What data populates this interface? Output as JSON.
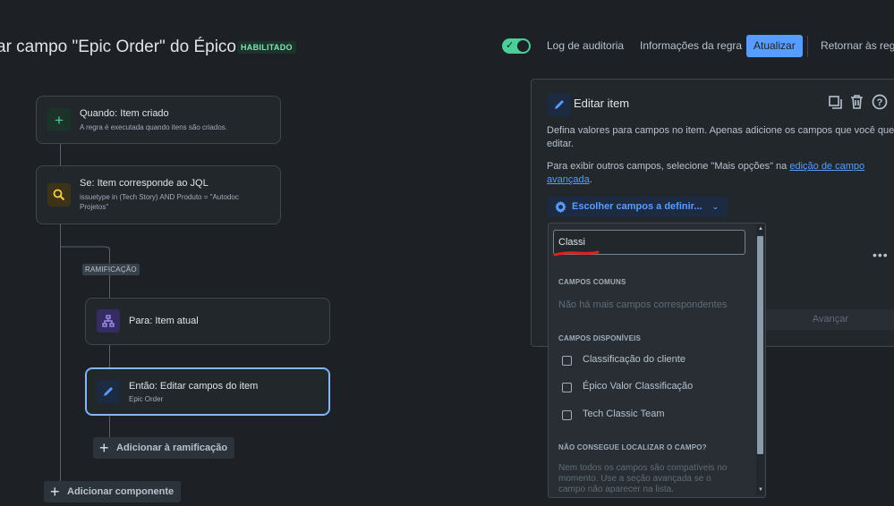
{
  "header": {
    "title": "ar campo \"Epic Order\" do Épico",
    "status": "HABILITADO",
    "toggle_on": true,
    "audit_log": "Log de auditoria",
    "rule_info": "Informações da regra",
    "update": "Atualizar",
    "return_rules": "Retornar às regra"
  },
  "flow": {
    "trigger": {
      "title": "Quando: Item criado",
      "subtitle": "A regra é executada quando itens são criados.",
      "icon": "plus-icon"
    },
    "condition": {
      "title": "Se: Item corresponde ao JQL",
      "subtitle_line1": "issuetype in (Tech Story) AND Produto = \"Autodoc",
      "subtitle_line2": "Projetos\"",
      "icon": "search-icon"
    },
    "branch_label": "RAMIFICAÇÃO",
    "branch": {
      "title": "Para: Item atual",
      "icon": "hierarchy-icon"
    },
    "action": {
      "title": "Então: Editar campos do item",
      "subtitle": "Epic Order",
      "icon": "pencil-icon"
    },
    "add_to_branch": "Adicionar à ramificação",
    "add_component": "Adicionar componente"
  },
  "panel": {
    "title": "Editar item",
    "desc_line1": "Defina valores para campos no item. Apenas adicione os campos que você quer",
    "desc_line2": "editar.",
    "other_fields_text": "Para exibir outros campos, selecione \"Mais opções\" na ",
    "other_fields_link1": "edição de campo",
    "other_fields_link2": "avançada",
    "other_fields_end": ".",
    "choose_fields": "Escolher campos a definir...",
    "advance": "Avançar",
    "more": "•••"
  },
  "dropdown": {
    "search_value": "Classi",
    "common_header": "CAMPOS COMUNS",
    "no_common": "Não há mais campos correspondentes",
    "available_header": "CAMPOS DISPONÍVEIS",
    "options": [
      {
        "label": "Classificação do cliente",
        "checked": false
      },
      {
        "label": "Épico Valor Classificação",
        "checked": false
      },
      {
        "label": "Tech Classic Team",
        "checked": false
      }
    ],
    "cant_find_header": "NÃO CONSEGUE LOCALIZAR O CAMPO?",
    "cant_find_line1": "Nem todos os campos são compatíveis no",
    "cant_find_line2": "momento. Use a seção avançada se o",
    "cant_find_line3": "campo não aparecer na lista."
  },
  "colors": {
    "background": "#1d2125",
    "accent": "#579dff",
    "success": "#4bce97",
    "annotation_red": "#e01e1e"
  }
}
